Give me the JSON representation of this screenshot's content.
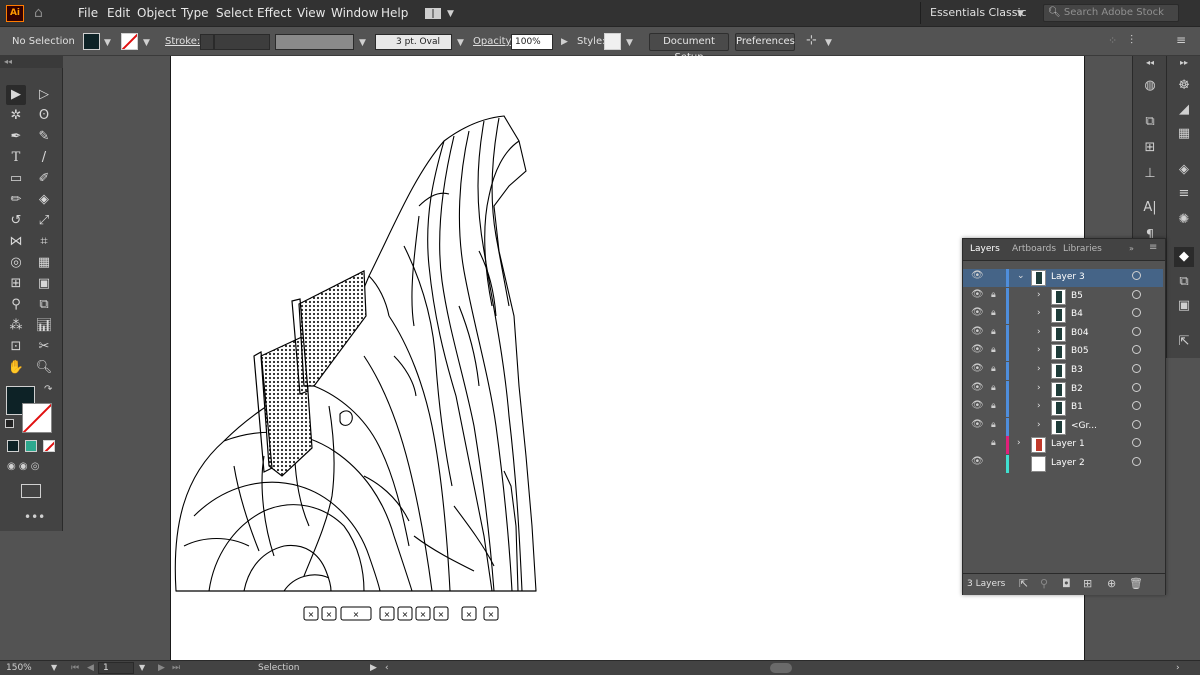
{
  "app": {
    "logo": "Ai",
    "home_icon": "home-icon"
  },
  "menu": [
    "File",
    "Edit",
    "Object",
    "Type",
    "Select",
    "Effect",
    "View",
    "Window",
    "Help"
  ],
  "workspace": "Essentials Classic",
  "stock_search": {
    "placeholder": "Search Adobe Stock"
  },
  "control": {
    "selection": "No Selection",
    "fill_color": "#0d2226",
    "stroke_label": "Stroke:",
    "brush": "3 pt. Oval",
    "opacity_label": "Opacity:",
    "opacity_value": "100%",
    "style_label": "Style:",
    "document_setup": "Document Setup",
    "preferences": "Preferences"
  },
  "layers_panel": {
    "tabs": [
      "Layers",
      "Artboards",
      "Libraries"
    ],
    "rows": [
      {
        "name": "Layer 3",
        "level": 0,
        "expanded": true,
        "color": "#4f8edc",
        "selected": true,
        "eye": true,
        "lock": false
      },
      {
        "name": "B5",
        "level": 1,
        "color": "#4f8edc",
        "eye": true,
        "lock": true
      },
      {
        "name": "B4",
        "level": 1,
        "color": "#4f8edc",
        "eye": true,
        "lock": true
      },
      {
        "name": "B04",
        "level": 1,
        "color": "#4f8edc",
        "eye": true,
        "lock": true
      },
      {
        "name": "B05",
        "level": 1,
        "color": "#4f8edc",
        "eye": true,
        "lock": true
      },
      {
        "name": "B3",
        "level": 1,
        "color": "#4f8edc",
        "eye": true,
        "lock": true
      },
      {
        "name": "B2",
        "level": 1,
        "color": "#4f8edc",
        "eye": true,
        "lock": true
      },
      {
        "name": "B1",
        "level": 1,
        "color": "#4f8edc",
        "eye": true,
        "lock": true
      },
      {
        "name": "<Gr...",
        "level": 1,
        "color": "#4f8edc",
        "eye": true,
        "lock": true
      },
      {
        "name": "Layer 1",
        "level": 0,
        "expanded": false,
        "color": "#e0207a",
        "eye": false,
        "lock": true
      },
      {
        "name": "Layer 2",
        "level": 0,
        "color": "#3fe0d0",
        "eye": true,
        "lock": false
      }
    ],
    "footer_count": "3 Layers"
  },
  "status": {
    "zoom": "150%",
    "artboard": "1",
    "tool": "Selection"
  }
}
